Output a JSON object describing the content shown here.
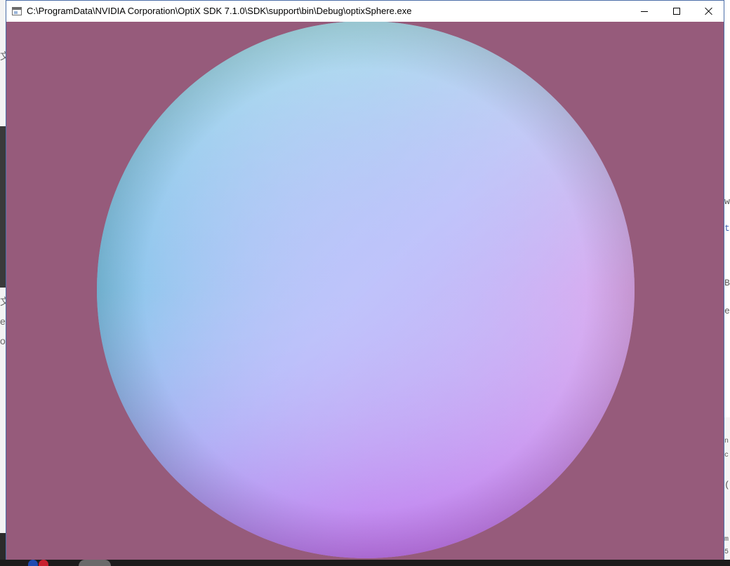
{
  "window": {
    "title": "C:\\ProgramData\\NVIDIA Corporation\\OptiX SDK 7.1.0\\SDK\\support\\bin\\Debug\\optixSphere.exe",
    "icon": "app-window-icon",
    "controls": {
      "minimize_icon": "minimize-icon",
      "maximize_icon": "maximize-icon",
      "close_icon": "close-icon"
    }
  },
  "render": {
    "background_color": "#965b7b",
    "sphere_colors": {
      "center": "#bfc3fb",
      "top": "#b7f0e8",
      "left": "#5ab8e0",
      "right": "#f3b8e6",
      "bottom": "#b45fea",
      "bottom_left": "#7b7fe8",
      "top_left": "#7ae6e0",
      "bottom_right": "#e874e8"
    }
  },
  "background_windows": {
    "left_glyphs": [
      "文",
      "文",
      "e",
      "o"
    ],
    "right_glyphs": [
      "w",
      "t",
      "Ba",
      "er",
      "n",
      "c",
      "(",
      "m",
      "5"
    ]
  }
}
